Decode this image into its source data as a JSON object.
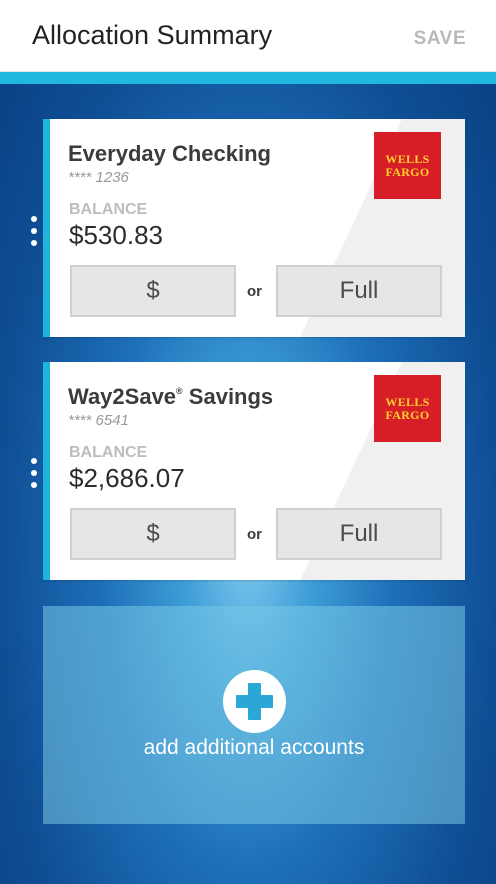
{
  "header": {
    "title": "Allocation Summary",
    "save_label": "SAVE"
  },
  "accounts": [
    {
      "name": "Everyday Checking",
      "masked_number": "**** 1236",
      "balance_label": "BALANCE",
      "balance": "$530.83",
      "bank_logo_line1": "WELLS",
      "bank_logo_line2": "FARGO",
      "dollar_button": "$",
      "or_label": "or",
      "full_button": "Full"
    },
    {
      "name": "Way2Save",
      "name_mark": "®",
      "name_suffix": " Savings",
      "masked_number": "**** 6541",
      "balance_label": "BALANCE",
      "balance": "$2,686.07",
      "bank_logo_line1": "WELLS",
      "bank_logo_line2": "FARGO",
      "dollar_button": "$",
      "or_label": "or",
      "full_button": "Full"
    }
  ],
  "add_accounts": {
    "label": "add additional accounts",
    "icon": "plus-circle-icon"
  },
  "colors": {
    "accent": "#21b8e0",
    "bank_red": "#d71e28",
    "bank_gold": "#ffd02b"
  }
}
